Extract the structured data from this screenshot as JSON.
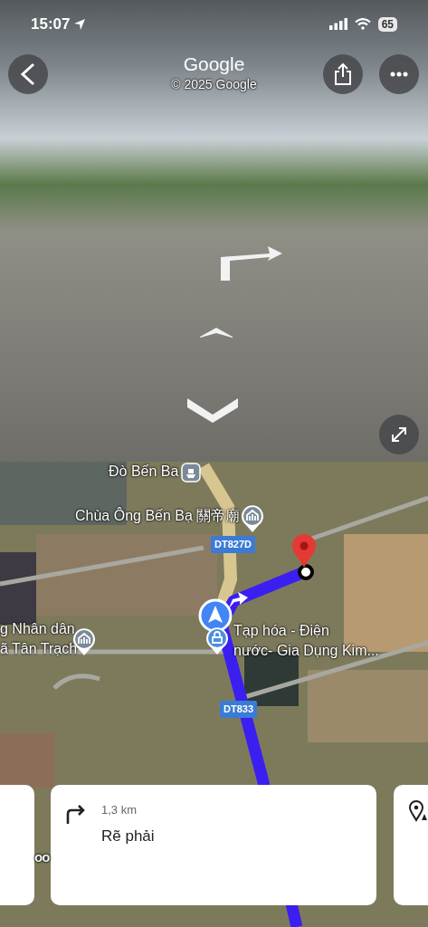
{
  "status_bar": {
    "time": "15:07",
    "battery": "65"
  },
  "street_view": {
    "title": "Google",
    "copyright": "© 2025 Google"
  },
  "map": {
    "places": [
      {
        "kind": "ferry",
        "lines": [
          "Đò Bến Ba"
        ]
      },
      {
        "kind": "temple",
        "lines": [
          "Chùa Ông Bến Bạ 關帝廟"
        ]
      },
      {
        "kind": "temple",
        "lines": [
          "g Nhân dân",
          "ã Tân Trạch"
        ]
      },
      {
        "kind": "shop",
        "lines": [
          "Tạp hóa - Điện",
          "nước- Gia Dụng Kim..."
        ]
      }
    ],
    "road_labels": [
      "DT827D",
      "DT833"
    ],
    "logo": "oo"
  },
  "step_card": {
    "distance": "1,3 km",
    "instruction": "Rẽ phải"
  }
}
